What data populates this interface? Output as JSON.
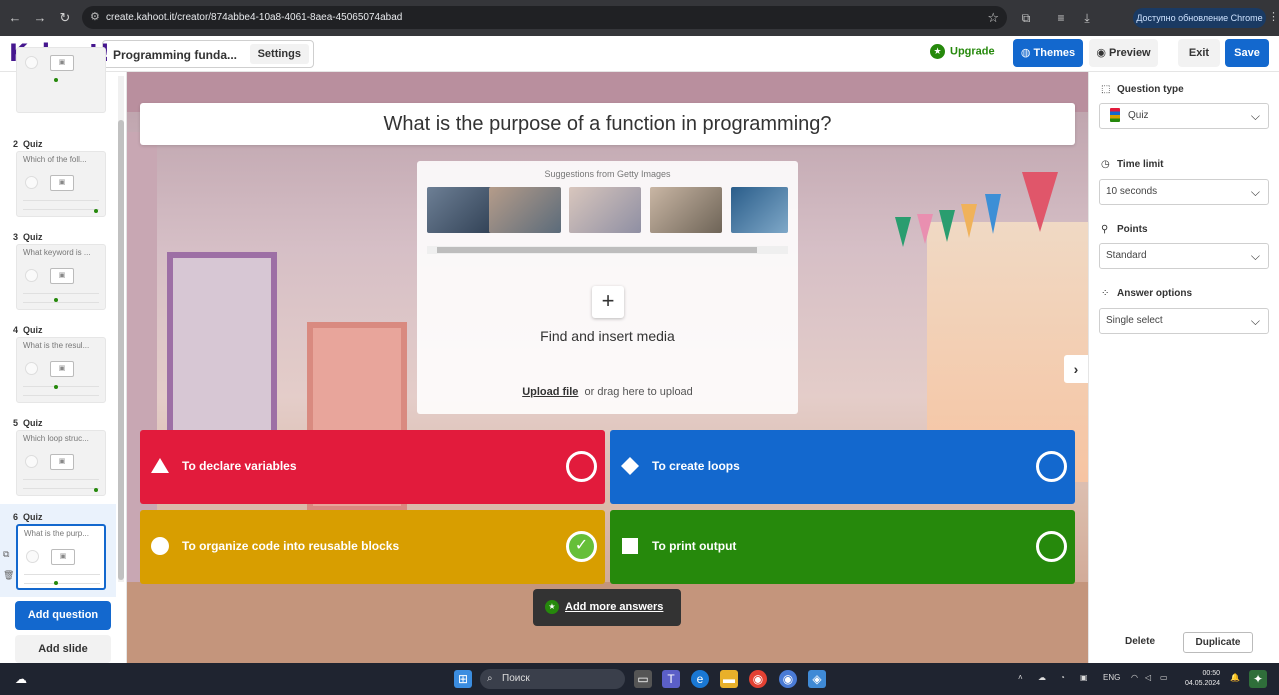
{
  "browser": {
    "url": "create.kahoot.it/creator/874abbe4-10a8-4061-8aea-45065074abad",
    "update_label": "Доступно обновление Chrome"
  },
  "header": {
    "logo": "Kahoot!",
    "quiz_title": "Programming funda...",
    "settings_label": "Settings",
    "upgrade_label": "Upgrade",
    "themes_label": "Themes",
    "preview_label": "Preview",
    "exit_label": "Exit",
    "save_label": "Save"
  },
  "sidebar": {
    "slides": [
      {
        "number": "2",
        "type": "Quiz",
        "question": "Which of the foll..."
      },
      {
        "number": "3",
        "type": "Quiz",
        "question": "What keyword is ..."
      },
      {
        "number": "4",
        "type": "Quiz",
        "question": "What is the resul..."
      },
      {
        "number": "5",
        "type": "Quiz",
        "question": "Which loop struc..."
      },
      {
        "number": "6",
        "type": "Quiz",
        "question": "What is the purp..."
      }
    ],
    "add_question_label": "Add question",
    "add_slide_label": "Add slide"
  },
  "editor": {
    "question": "What is the purpose of a function in programming?",
    "media": {
      "suggestions_label": "Suggestions from Getty Images",
      "find_label": "Find and insert media",
      "upload_link": "Upload file",
      "upload_hint": "or drag here to upload"
    },
    "answers": [
      {
        "text": "To declare variables",
        "shape": "triangle",
        "color": "#e21b3c",
        "correct": false
      },
      {
        "text": "To create loops",
        "shape": "diamond",
        "color": "#1368ce",
        "correct": false
      },
      {
        "text": "To organize code into reusable blocks",
        "shape": "circle",
        "color": "#d89e00",
        "correct": true
      },
      {
        "text": "To print output",
        "shape": "square",
        "color": "#26890c",
        "correct": false
      }
    ],
    "add_more_label": "Add more answers"
  },
  "panel": {
    "question_type_label": "Question type",
    "question_type_value": "Quiz",
    "time_limit_label": "Time limit",
    "time_limit_value": "10 seconds",
    "points_label": "Points",
    "points_value": "Standard",
    "answer_options_label": "Answer options",
    "answer_options_value": "Single select",
    "delete_label": "Delete",
    "duplicate_label": "Duplicate"
  },
  "taskbar": {
    "search_placeholder": "Поиск",
    "lang": "ENG",
    "time": "00:50",
    "date": "04.05.2024"
  }
}
